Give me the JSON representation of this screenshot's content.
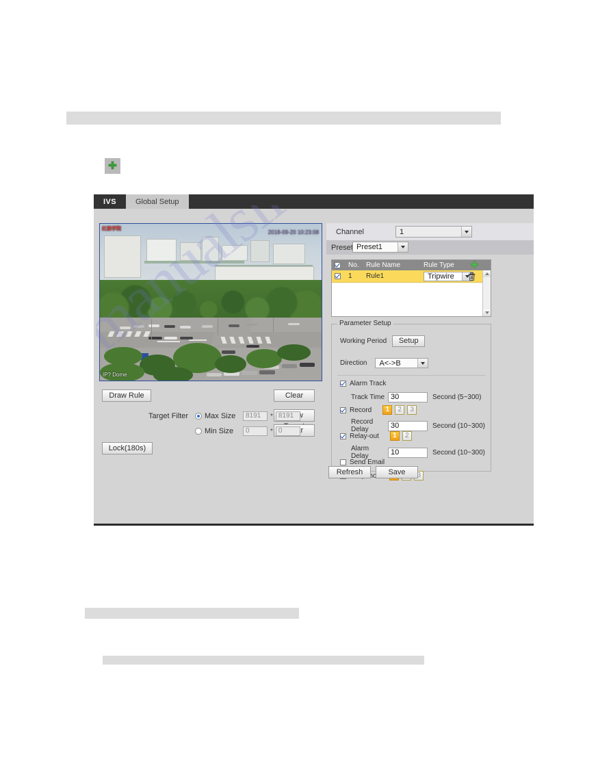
{
  "page": {
    "watermark": "manualslive.com"
  },
  "panel": {
    "tabs": [
      {
        "label": "IVS",
        "active": true
      },
      {
        "label": "Global Setup",
        "active": false
      }
    ]
  },
  "add_icon_above_panel": "add-plus-icon",
  "video": {
    "osd_top_left": "红旗学院",
    "osd_top_right": "2018-09-20 10:23:08",
    "osd_bottom_left": "IP? Dome"
  },
  "left_controls": {
    "draw_rule_button": "Draw Rule",
    "clear_button_1": "Clear",
    "target_filter_label": "Target Filter",
    "max_size": {
      "label": "Max Size",
      "selected": true,
      "width": "8191",
      "separator": "*",
      "height": "8191"
    },
    "min_size": {
      "label": "Min Size",
      "selected": false,
      "width": "0",
      "separator": "*",
      "height": "0"
    },
    "draw_target_button": "Draw Target",
    "clear_button_2": "Clear",
    "lock_button": "Lock(180s)"
  },
  "right_panel": {
    "channel_label": "Channel",
    "channel_value": "1",
    "preset_label": "Preset",
    "preset_value": "Preset1",
    "rule_table": {
      "header_checkbox_checked": true,
      "columns": [
        "No.",
        "Rule Name",
        "Rule Type"
      ],
      "add_icon": "add-plus-icon",
      "rows": [
        {
          "checked": true,
          "no": "1",
          "name": "Rule1",
          "type": "Tripwire",
          "delete_icon": "trash-icon"
        }
      ]
    },
    "parameter_setup": {
      "legend": "Parameter Setup",
      "working_period_label": "Working Period",
      "setup_button": "Setup",
      "direction_label": "Direction",
      "direction_value": "A<->B",
      "alarm_track": {
        "label": "Alarm Track",
        "checked": true
      },
      "track_time": {
        "label": "Track Time",
        "value": "30",
        "unit": "Second (5~300)"
      },
      "record": {
        "label": "Record",
        "checked": true,
        "channels": [
          "1",
          "2",
          "3"
        ],
        "selected": [
          "1"
        ]
      },
      "record_delay": {
        "label": "Record Delay",
        "value": "30",
        "unit": "Second (10~300)"
      },
      "relay_out": {
        "label": "Relay-out",
        "checked": true,
        "channels": [
          "1",
          "2"
        ],
        "selected": [
          "1"
        ]
      },
      "alarm_delay": {
        "label": "Alarm Delay",
        "value": "10",
        "unit": "Second (10~300)"
      },
      "send_email": {
        "label": "Send Email",
        "checked": false
      },
      "snapshot": {
        "label": "Snapshot",
        "checked": true,
        "channels": [
          "1",
          "2",
          "3"
        ],
        "selected": [
          "1"
        ]
      }
    },
    "refresh_button": "Refresh",
    "save_button": "Save"
  },
  "colors": {
    "accent_orange": "#f0a018",
    "row_highlight": "#fbda5b",
    "tab_active_bg": "#333333",
    "panel_bg": "#d4d4d4",
    "add_icon_green": "#3aa03a"
  }
}
